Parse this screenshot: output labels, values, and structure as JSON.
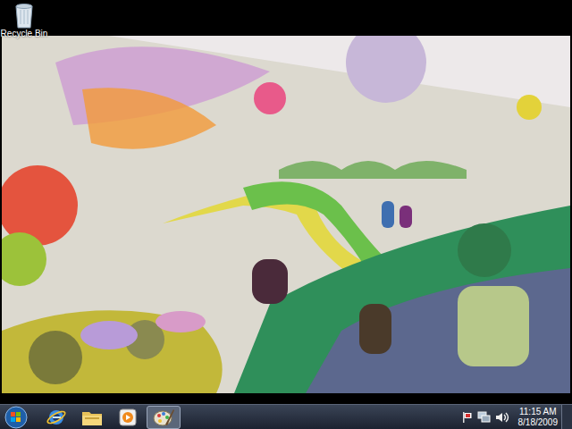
{
  "desktop": {
    "icons": [
      {
        "label": "Recycle Bin"
      }
    ]
  },
  "taskbar": {
    "items": [
      {
        "kind": "ie",
        "selected": false
      },
      {
        "kind": "explorer",
        "selected": false
      },
      {
        "kind": "media",
        "selected": false
      },
      {
        "kind": "paint",
        "selected": true
      }
    ],
    "tray": [
      {
        "kind": "flag"
      },
      {
        "kind": "network"
      },
      {
        "kind": "volume"
      }
    ],
    "clock": {
      "time": "11:15 AM",
      "date": "8/18/2009"
    }
  }
}
